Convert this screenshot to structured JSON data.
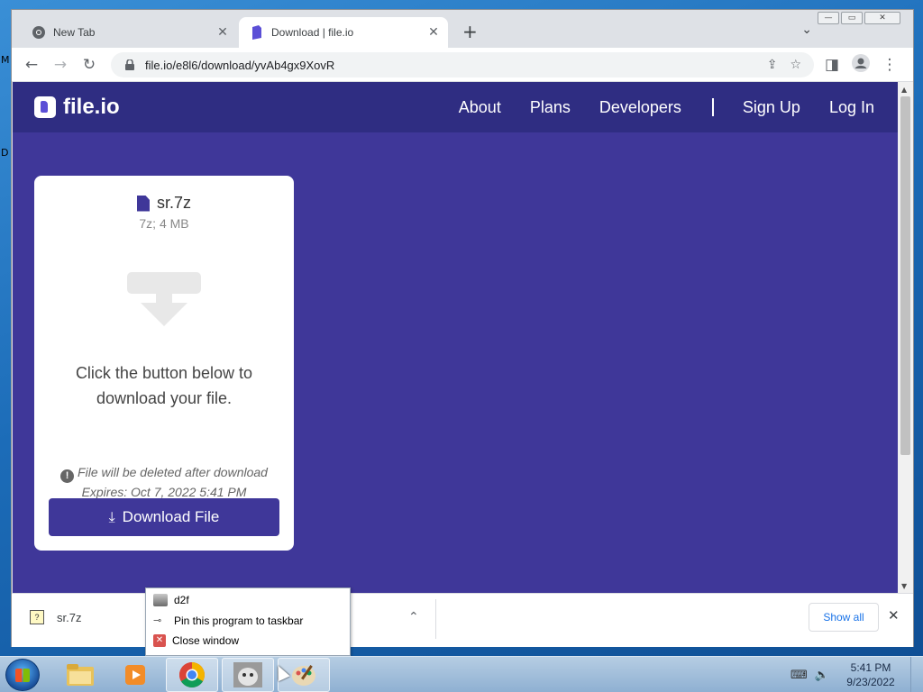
{
  "desktop": {
    "left_fragment_1": "M",
    "left_fragment_2": "D"
  },
  "window": {
    "min": "—",
    "max": "▭",
    "close": "✕"
  },
  "tabs": [
    {
      "title": "New Tab",
      "close": "✕"
    },
    {
      "title": "Download | file.io",
      "close": "✕"
    }
  ],
  "new_tab": "+",
  "tab_list": "⌄",
  "toolbar": {
    "back": "←",
    "forward": "→",
    "reload": "↻",
    "url": "file.io/e8l6/download/yvAb4gx9XovR",
    "share": "⇪",
    "star": "☆",
    "sidepanel": "◨",
    "menu": "⋮"
  },
  "site": {
    "logo": "file.io",
    "nav": {
      "about": "About",
      "plans": "Plans",
      "developers": "Developers",
      "signup": "Sign Up",
      "login": "Log In"
    }
  },
  "card": {
    "file_name": "sr.7z",
    "file_meta": "7z; 4 MB",
    "instruction": "Click the button below to download your file.",
    "note_icon": "!",
    "delete_note": "File will be deleted after download",
    "expires": "Expires: Oct 7, 2022 5:41 PM",
    "button": "Download File",
    "button_icon": "⤓"
  },
  "shelf": {
    "file": "sr.7z",
    "file_icon": "?",
    "chevron": "⌃",
    "show_all": "Show all",
    "close": "✕"
  },
  "jumplist": {
    "app": "d2f",
    "pin": "Pin this program to taskbar",
    "close": "Close window"
  },
  "taskbar": {
    "time": "5:41 PM",
    "date": "9/23/2022",
    "network": "⌨",
    "volume": "🔈"
  },
  "colors": {
    "brand": "#3f3799",
    "nav": "#2f2d82"
  }
}
